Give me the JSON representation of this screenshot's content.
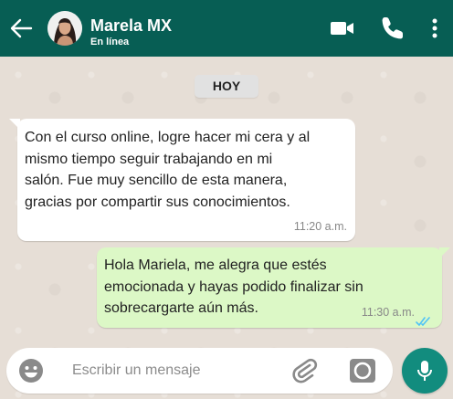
{
  "header": {
    "contact_name": "Marela MX",
    "status": "En línea",
    "color": "#075e54"
  },
  "icons": {
    "back": "arrow-left-icon",
    "video": "video-camera-icon",
    "call": "phone-icon",
    "menu": "more-vertical-icon",
    "emoji": "emoji-face-icon",
    "attach": "paperclip-icon",
    "camera": "camera-icon",
    "mic": "microphone-icon",
    "read": "double-check-icon"
  },
  "date_divider": "HOY",
  "messages": [
    {
      "direction": "incoming",
      "lines": [
        "Con el curso online, logre hacer mi cera y al",
        "mismo tiempo seguir trabajando en mi",
        "salón. Fue muy sencillo de esta manera,",
        "gracias por compartir sus conocimientos."
      ],
      "time": "11:20 a.m."
    },
    {
      "direction": "outgoing",
      "lines": [
        "Hola Mariela, me alegra que estés",
        "emocionada y hayas podido finalizar sin",
        "sobrecargarte aún más."
      ],
      "time": "11:30 a.m.",
      "read_color": "#4fc3f7"
    }
  ],
  "composer": {
    "placeholder": "Escribir un mensaje",
    "value": ""
  },
  "colors": {
    "incoming_bubble": "#ffffff",
    "outgoing_bubble": "#dcf8c6",
    "accent": "#128c7e"
  }
}
